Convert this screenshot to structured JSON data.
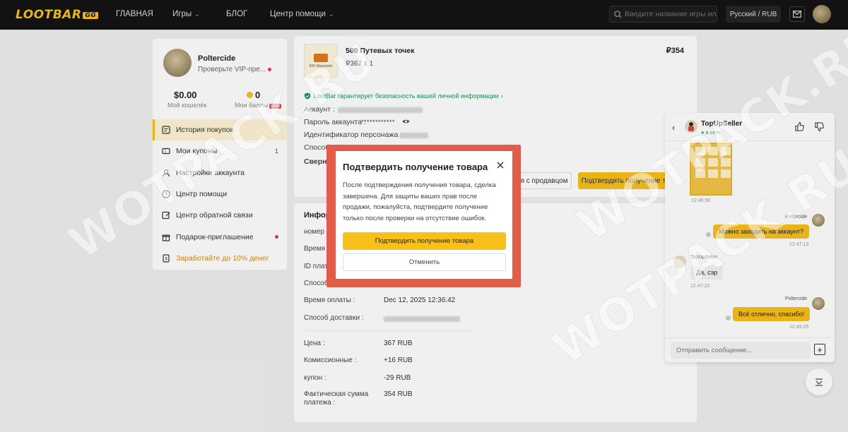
{
  "header": {
    "logo": "LOOTBAR",
    "logo_badge": "GG",
    "nav": [
      "ГЛАВНАЯ",
      "Игры",
      "БЛОГ",
      "Центр помощи"
    ],
    "search_placeholder": "Введите название игры или т",
    "lang": "Русский / RUB"
  },
  "sidebar": {
    "username": "Poltercide",
    "vip": "Проверьте VIP-пре...",
    "wallet_value": "$0.00",
    "wallet_label": "Мой кошелёк",
    "points_value": "0",
    "points_label": "Мои баллы",
    "points_badge": "new",
    "items": [
      {
        "label": "История покупок",
        "icon": "order-history-icon"
      },
      {
        "label": "Мои купоны",
        "icon": "coupon-icon",
        "count": "1"
      },
      {
        "label": "Настройки аккаунта",
        "icon": "account-settings-icon"
      },
      {
        "label": "Центр помощи",
        "icon": "help-icon"
      },
      {
        "label": "Центр обратной связи",
        "icon": "feedback-icon"
      },
      {
        "label": "Подарок-приглашение",
        "icon": "gift-icon"
      },
      {
        "label": "Заработайте до 10% денег",
        "icon": "money-icon"
      }
    ]
  },
  "order": {
    "product_title": "500 Путевых точек",
    "product_img_caption": "500 Waypoints",
    "unit_price": "₽367 x 1",
    "total": "₽354",
    "guarantee": "LootBar гарантирует безопасность вашей личной информации",
    "fields": [
      "Аккаунт :",
      "Пароль аккаунта :",
      "Идентификатор персонажа :",
      "Способ",
      "Свернут"
    ],
    "password_mask": "************",
    "contact_seller": "ься с продавцом",
    "confirm_receipt": "Подтвердить получение то"
  },
  "info": {
    "heading": "Инфор",
    "rows": [
      {
        "label": "номер :",
        "value": ""
      },
      {
        "label": "Время с",
        "value": ""
      },
      {
        "label": "ID плате",
        "value": ""
      },
      {
        "label": "Способ",
        "value": ""
      },
      {
        "label": "Время оплаты :",
        "value": "Dec 12, 2025 12:36:42"
      },
      {
        "label": "Способ доставки :",
        "value": ""
      }
    ],
    "price_rows": [
      {
        "label": "Цена :",
        "value": "367 RUB"
      },
      {
        "label": "Комиссионные :",
        "value": "+16 RUB"
      },
      {
        "label": "купон :",
        "value": "-29 RUB"
      },
      {
        "label": "Фактическая сумма платежа :",
        "value": "354 RUB"
      }
    ]
  },
  "chat": {
    "seller": "TopUpSeller",
    "status": "в сети",
    "messages": [
      {
        "time": "12:46:56"
      },
      {
        "sender": "Poltercide",
        "text": "Можно заходить на аккаунт?",
        "time": "12:47:13"
      },
      {
        "sender": "TopUpSeller",
        "text": "Да, сэр",
        "time": "12:47:22"
      },
      {
        "sender": "Poltercide",
        "text": "Всё отлично, спасибо!",
        "time": "12:49:25"
      }
    ],
    "input_placeholder": "Отправить сообщение..."
  },
  "modal": {
    "title": "Подтвердить получение товара",
    "body": "После подтверждения получения товара, сделка завершена. Для защиты ваших прав после продажи, пожалуйста, подтвердите получение только после проверки на отсутствие ошибок.",
    "confirm": "Подтвердить получение товара",
    "cancel": "Отменить"
  },
  "watermarks": [
    "WOTPACK.RU",
    "WOTPACK.RU",
    "WOTPACK.RU"
  ],
  "colors": {
    "accent": "#f7c01a",
    "highlight_border": "#e25c4a",
    "header_bg": "#141414",
    "success": "#1a9a5a"
  }
}
